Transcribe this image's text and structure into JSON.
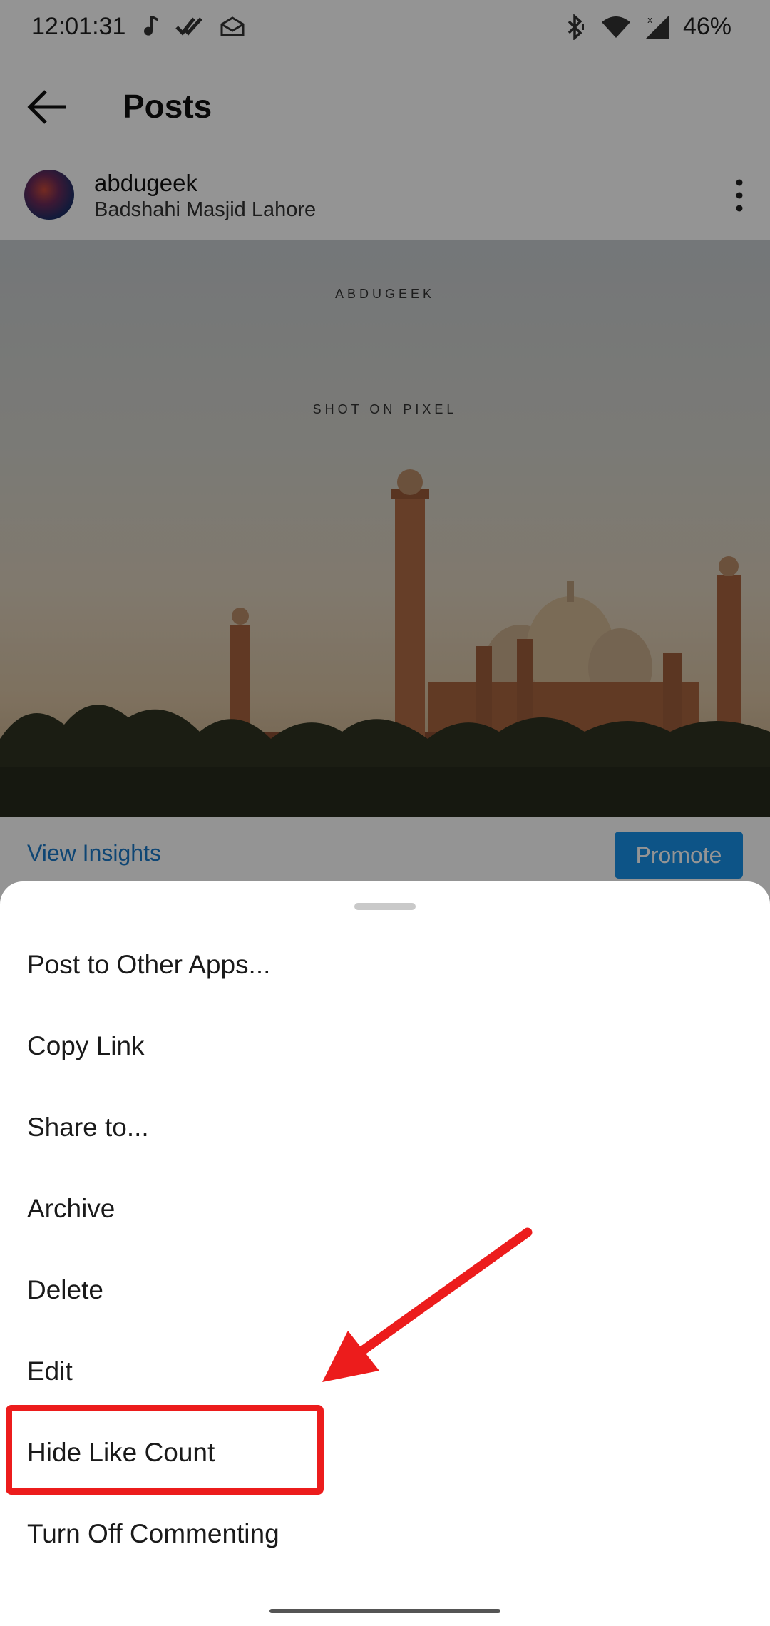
{
  "status_bar": {
    "time": "12:01:31",
    "left_icons": [
      "music-note-icon",
      "double-check-icon",
      "mail-icon"
    ],
    "right_icons": [
      "bluetooth-icon",
      "wifi-icon",
      "signal-icon"
    ],
    "battery": "46%"
  },
  "header": {
    "back_icon": "arrow-left-icon",
    "title": "Posts"
  },
  "post": {
    "username": "abdugeek",
    "location": "Badshahi Masjid Lahore",
    "image_text_top": "ABDUGEEK",
    "image_text_mid": "SHOT ON PIXEL",
    "view_insights": "View Insights",
    "promote": "Promote"
  },
  "sheet": {
    "items": [
      {
        "label": "Post to Other Apps..."
      },
      {
        "label": "Copy Link"
      },
      {
        "label": "Share to..."
      },
      {
        "label": "Archive"
      },
      {
        "label": "Delete"
      },
      {
        "label": "Edit"
      },
      {
        "label": "Hide Like Count"
      },
      {
        "label": "Turn Off Commenting"
      }
    ]
  },
  "colors": {
    "annotation": "#ec1c1c",
    "accent": "#1791e8",
    "link": "#1b79c9"
  }
}
